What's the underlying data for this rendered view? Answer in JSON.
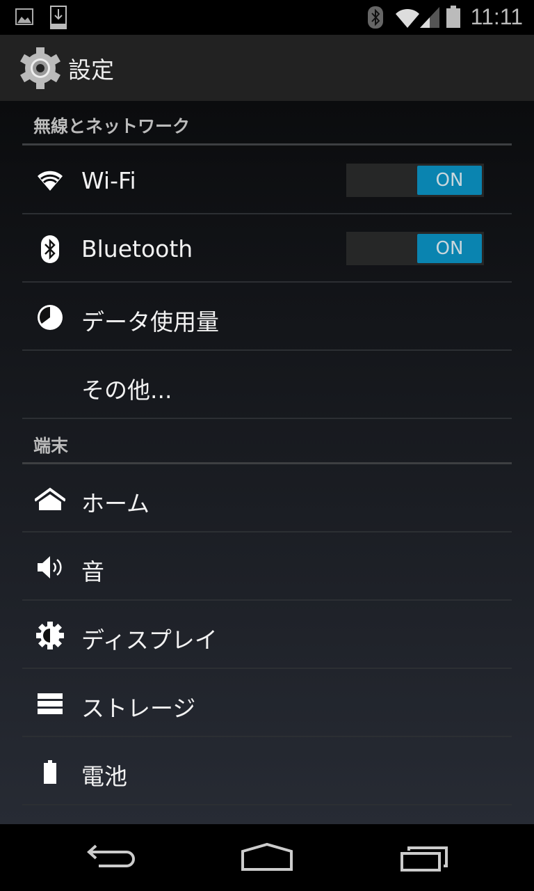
{
  "status_bar": {
    "time": "11:11",
    "icons": [
      "image-icon",
      "download-icon",
      "bluetooth-icon",
      "wifi-icon",
      "signal-icon",
      "battery-icon"
    ]
  },
  "action_bar": {
    "title": "設定",
    "icon": "gear-icon"
  },
  "sections": [
    {
      "header": "無線とネットワーク",
      "items": [
        {
          "label": "Wi-Fi",
          "icon": "wifi-icon",
          "toggle": "ON"
        },
        {
          "label": "Bluetooth",
          "icon": "bluetooth-icon",
          "toggle": "ON"
        },
        {
          "label": "データ使用量",
          "icon": "data-usage-icon"
        },
        {
          "label": "その他..."
        }
      ]
    },
    {
      "header": "端末",
      "items": [
        {
          "label": "ホーム",
          "icon": "home-icon"
        },
        {
          "label": "音",
          "icon": "sound-icon"
        },
        {
          "label": "ディスプレイ",
          "icon": "display-icon"
        },
        {
          "label": "ストレージ",
          "icon": "storage-icon"
        },
        {
          "label": "電池",
          "icon": "battery-icon"
        }
      ]
    }
  ],
  "colors": {
    "accent": "#0a84b0",
    "actionbar": "#222222"
  }
}
